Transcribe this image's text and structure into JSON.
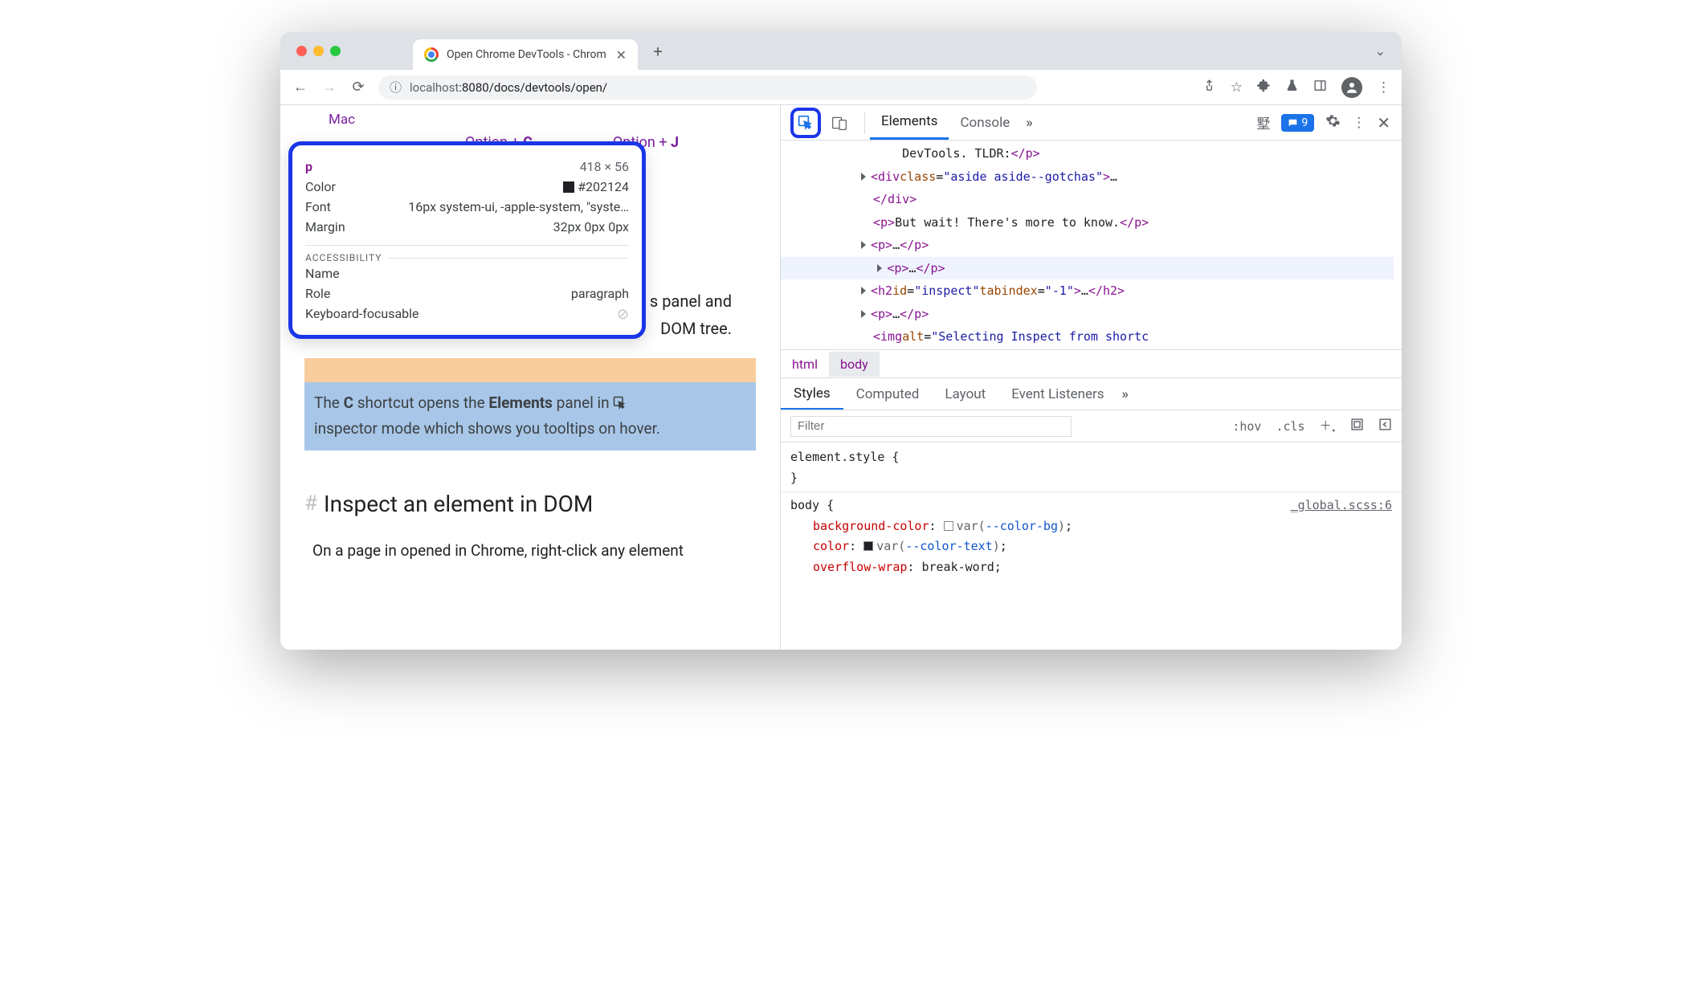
{
  "browser": {
    "tab_title": "Open Chrome DevTools - Chrom",
    "url_host": "localhost",
    "url_path": ":8080/docs/devtools/open/"
  },
  "page": {
    "mac_label": "Mac",
    "shortcut_c": "Option + ",
    "shortcut_c_key": "C",
    "shortcut_j": "Option + ",
    "shortcut_j_key": "J",
    "panel_text_tail": "s panel and",
    "dom_tree_tail": "DOM tree.",
    "hl_text_1a": "The ",
    "hl_text_1b": "C",
    "hl_text_1c": " shortcut opens the ",
    "hl_text_1d": "Elements",
    "hl_text_1e": " panel in ",
    "hl_text_2": "inspector mode which shows you tooltips on hover.",
    "h2": "Inspect an element in DOM",
    "para2": "On a page in opened in Chrome, right-click any element"
  },
  "tooltip": {
    "tag": "p",
    "dimensions": "418 × 56",
    "color_label": "Color",
    "color_value": "#202124",
    "font_label": "Font",
    "font_value": "16px system-ui, -apple-system, \"syste…",
    "margin_label": "Margin",
    "margin_value": "32px 0px 0px",
    "a11y_header": "ACCESSIBILITY",
    "name_label": "Name",
    "role_label": "Role",
    "role_value": "paragraph",
    "kbd_label": "Keyboard-focusable"
  },
  "devtools": {
    "tabs": {
      "elements": "Elements",
      "console": "Console"
    },
    "issues_count": "9",
    "dom": {
      "line1_text": "DevTools. TLDR:",
      "line2_class": "aside aside--gotchas",
      "line4_text": "But wait! There's more to know.",
      "h2_id": "inspect",
      "h2_tabindex": "-1",
      "img_alt": "Selecting Inspect from shortc"
    },
    "breadcrumb": {
      "html": "html",
      "body": "body"
    },
    "styles_tabs": {
      "styles": "Styles",
      "computed": "Computed",
      "layout": "Layout",
      "listeners": "Event Listeners"
    },
    "styles_toolbar": {
      "filter_placeholder": "Filter",
      "hov": ":hov",
      "cls": ".cls"
    },
    "css": {
      "element_style": "element.style {",
      "close": "}",
      "body_open": "body {",
      "src": "_global.scss:6",
      "bg_prop": "background-color",
      "bg_val_prefix": "var(",
      "bg_var": "--color-bg",
      "color_prop": "color",
      "color_var": "--color-text",
      "wrap_prop": "overflow-wrap",
      "wrap_val": "break-word"
    }
  }
}
